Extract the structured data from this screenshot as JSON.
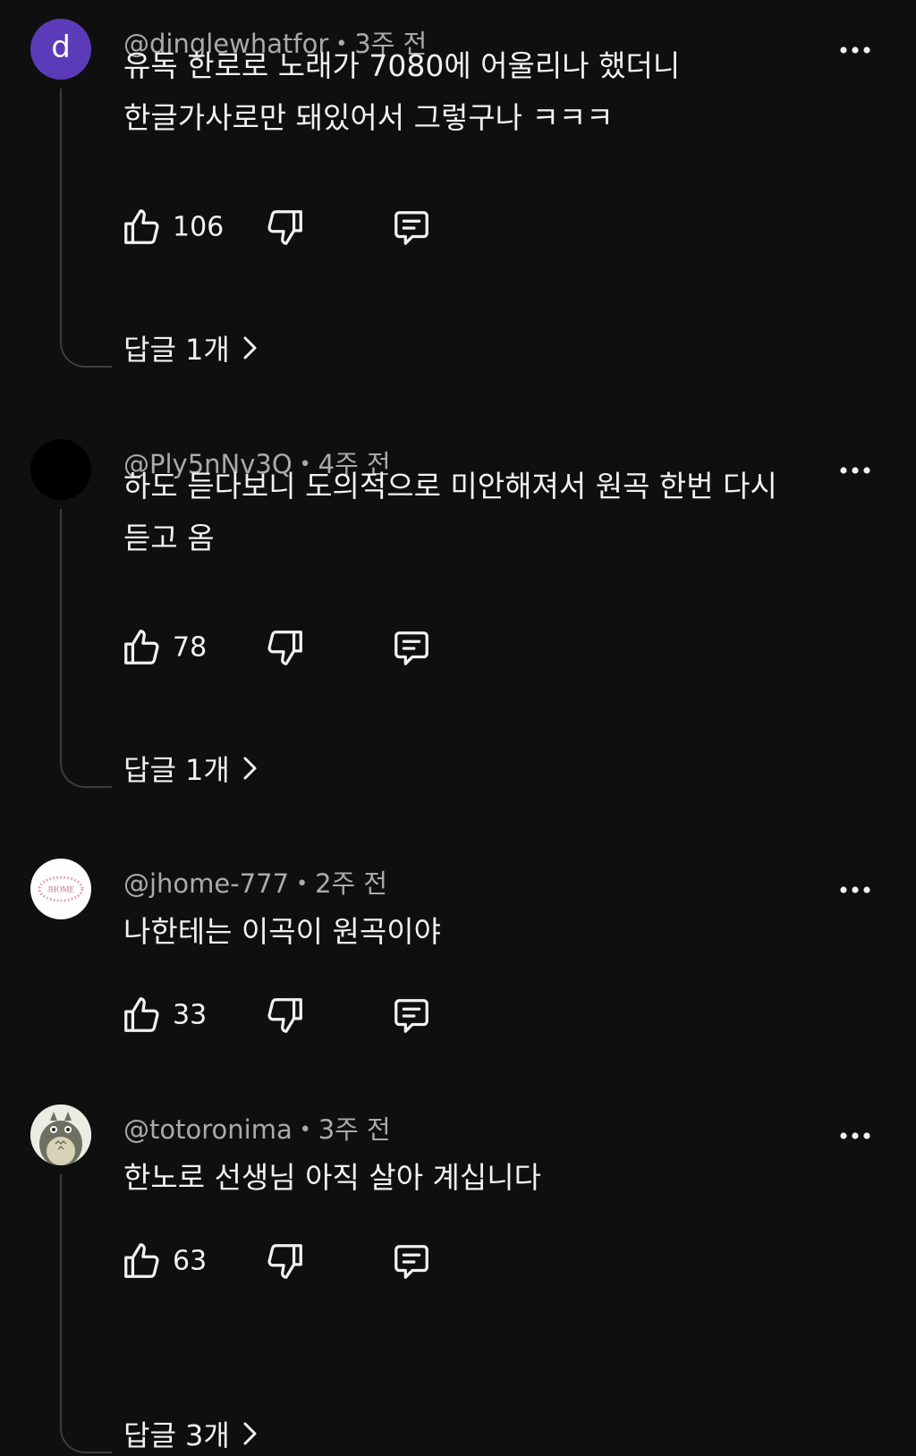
{
  "comments": [
    {
      "avatar_letter": "d",
      "avatar_color": "#5b3bb8",
      "username": "@dinglewhatfor",
      "time": "3주 전",
      "text": "유독 한로로 노래가 7080에 어울리나 했더니\n한글가사로만 돼있어서 그렇구나 ㅋㅋㅋ",
      "likes": "106",
      "replies_label": "답글 1개"
    },
    {
      "avatar_color": "#000000",
      "username": "@Ply5nNv3Q",
      "time": "4주 전",
      "text": "하도 듣다보니 도의적으로 미안해져서 원곡 한번 다시\n듣고 옴",
      "likes": "78",
      "replies_label": "답글 1개"
    },
    {
      "avatar_text": "JHOME",
      "avatar_color": "#ffffff",
      "username": "@jhome-777",
      "time": "2주 전",
      "text": "나한테는 이곡이 원곡이야",
      "likes": "33"
    },
    {
      "avatar_color": "#e9e7df",
      "username": "@totoronima",
      "time": "3주 전",
      "text": "한노로 선생님 아직 살아 계십니다",
      "likes": "63",
      "replies_label": "답글 3개"
    }
  ],
  "icons": {
    "more": "more-vert-icon",
    "like": "thumbs-up-icon",
    "dislike": "thumbs-down-icon",
    "reply": "reply-icon",
    "chevron": "chevron-right-icon"
  },
  "colors": {
    "background": "#0f0f0f",
    "text": "#f1f1f1",
    "meta": "#aaaaaa"
  }
}
